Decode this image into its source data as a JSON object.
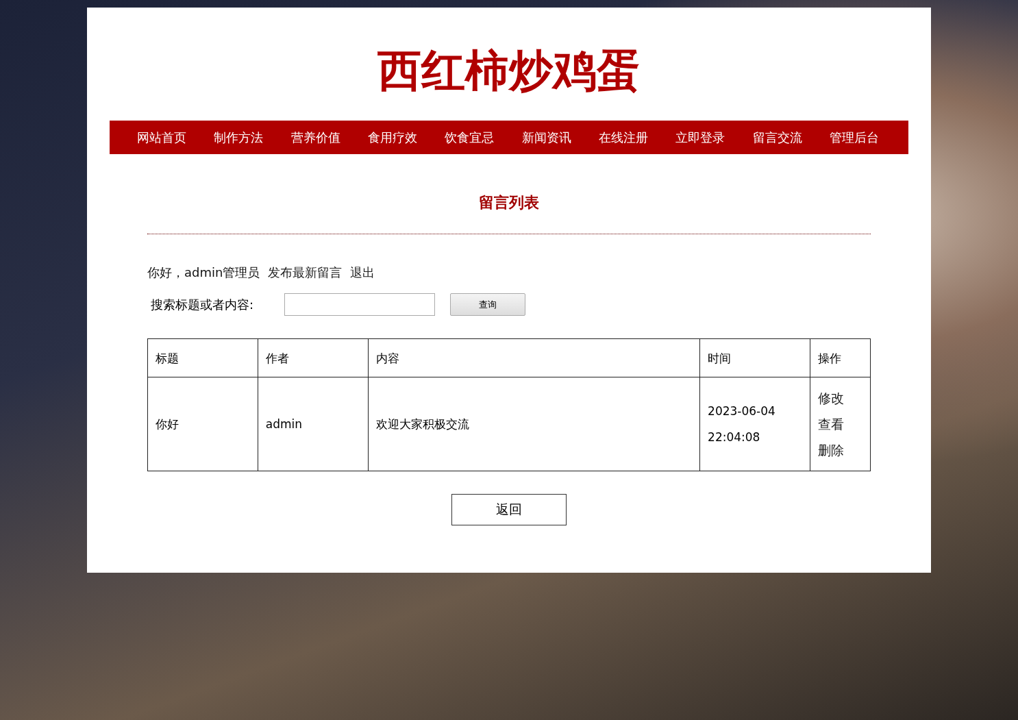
{
  "site_title": "西红柿炒鸡蛋",
  "nav": [
    "网站首页",
    "制作方法",
    "营养价值",
    "食用疗效",
    "饮食宜忌",
    "新闻资讯",
    "在线注册",
    "立即登录",
    "留言交流",
    "管理后台"
  ],
  "heading": "留言列表",
  "greeting": {
    "text": "你好，admin管理员",
    "links": [
      "发布最新留言",
      "退出"
    ]
  },
  "search": {
    "label": "搜索标题或者内容:",
    "button": "查询"
  },
  "table": {
    "columns": [
      "标题",
      "作者",
      "内容",
      "时间",
      "操作"
    ],
    "rows": [
      {
        "title": "你好",
        "author": "admin",
        "content": "欢迎大家积极交流",
        "time": "2023-06-04 22:04:08",
        "actions": [
          "修改",
          "查看",
          "删除"
        ]
      }
    ]
  },
  "back_button": "返回"
}
